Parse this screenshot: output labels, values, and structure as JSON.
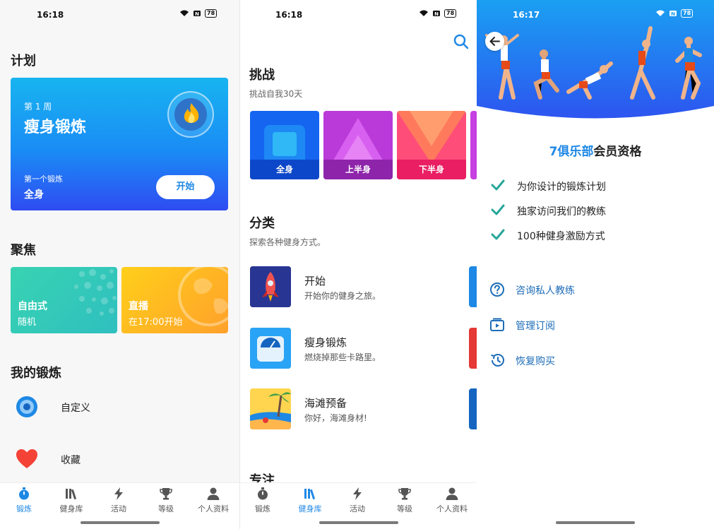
{
  "panel1": {
    "status": {
      "time": "16:18",
      "battery": "78"
    },
    "plan": {
      "heading": "计划",
      "week": "第 1 周",
      "title": "瘦身锻炼",
      "first_label": "第一个锻炼",
      "first_name": "全身",
      "start_label": "开始"
    },
    "focus": {
      "heading": "聚焦",
      "cards": [
        {
          "title": "自由式",
          "subtitle": "随机",
          "color": "#33c9b6"
        },
        {
          "title": "直播",
          "subtitle": "在17:00开始",
          "color": "#ffb722"
        }
      ]
    },
    "mine": {
      "heading": "我的锻炼",
      "items": [
        {
          "label": "自定义",
          "icon": "target-icon"
        },
        {
          "label": "收藏",
          "icon": "heart-icon"
        }
      ]
    },
    "nav": {
      "active": 0
    }
  },
  "nav_items": [
    {
      "label": "锻炼",
      "icon": "stopwatch-icon"
    },
    {
      "label": "健身库",
      "icon": "library-icon"
    },
    {
      "label": "活动",
      "icon": "bolt-icon"
    },
    {
      "label": "等级",
      "icon": "trophy-icon"
    },
    {
      "label": "个人资料",
      "icon": "person-icon"
    }
  ],
  "panel2": {
    "status": {
      "time": "16:18",
      "battery": "78"
    },
    "challenge": {
      "heading": "挑战",
      "subtitle": "挑战自我30天",
      "cards": [
        {
          "label": "全身",
          "color": "#1565f0"
        },
        {
          "label": "上半身",
          "color": "#c63fe0"
        },
        {
          "label": "下半身",
          "color": "#ff4d79"
        }
      ]
    },
    "category": {
      "heading": "分类",
      "subtitle": "探索各种健身方式。",
      "items": [
        {
          "title": "开始",
          "subtitle": "开始你的健身之旅。",
          "icon": "rocket-icon"
        },
        {
          "title": "瘦身锻炼",
          "subtitle": "燃烧掉那些卡路里。",
          "icon": "scale-icon"
        },
        {
          "title": "海滩预备",
          "subtitle": "你好，海滩身材!",
          "icon": "beach-icon"
        }
      ]
    },
    "next_heading": "专注",
    "nav": {
      "active": 1
    }
  },
  "panel3": {
    "status": {
      "time": "16:17",
      "battery": "78"
    },
    "title_accent": "7俱乐部",
    "title_rest": "会员资格",
    "benefits": [
      "为你设计的锻炼计划",
      "独家访问我们的教练",
      "100种健身激励方式"
    ],
    "links": [
      {
        "label": "咨询私人教练",
        "icon": "help-circle-icon"
      },
      {
        "label": "管理订阅",
        "icon": "subscription-icon"
      },
      {
        "label": "恢复购买",
        "icon": "history-icon"
      }
    ]
  }
}
